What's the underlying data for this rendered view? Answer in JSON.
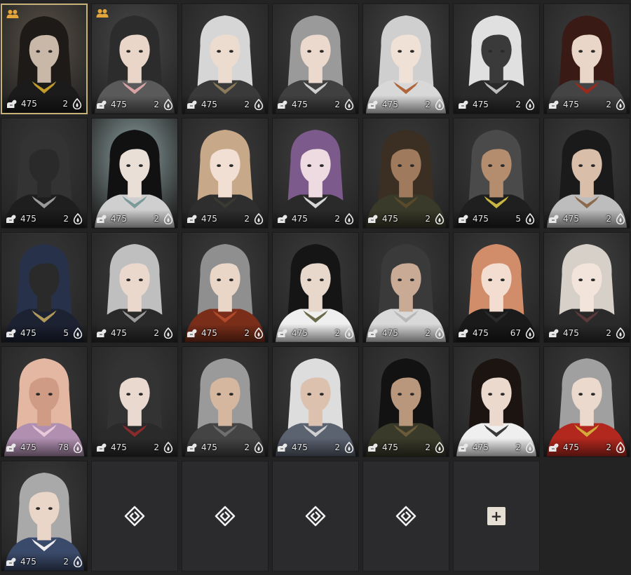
{
  "colors": {
    "background": "#232323",
    "selected_border": "#c9b27a",
    "party_icon": "#e4a63a",
    "empty_slot": "#2b2b2d",
    "add_button": "#e6dfd4"
  },
  "icons": {
    "party": "party-members-icon",
    "combat_power": "flexed-arm-icon",
    "energy": "energy-flame-icon",
    "slot": "diamond-spiral-icon",
    "add": "plus-icon"
  },
  "characters": [
    {
      "cp": "475",
      "energy": "2",
      "party": true,
      "selected": true,
      "look": {
        "hair": "#1d1a17",
        "skin": "#c9b8a8",
        "outfit": "#1b1b1b",
        "accent": "#c19a2b",
        "bg": "#5b5245"
      }
    },
    {
      "cp": "475",
      "energy": "2",
      "party": true,
      "look": {
        "hair": "#2c2c2c",
        "skin": "#e9d6c8",
        "outfit": "#5a5a5a",
        "accent": "#d9a3a3",
        "bg": "#4a4a4a"
      }
    },
    {
      "cp": "475",
      "energy": "2",
      "look": {
        "hair": "#d6d6d6",
        "skin": "#ecdccf",
        "outfit": "#3a3a3a",
        "accent": "#8a7a5a",
        "bg": "#3a3a3a"
      }
    },
    {
      "cp": "475",
      "energy": "2",
      "look": {
        "hair": "#9a9a9a",
        "skin": "#ead9cc",
        "outfit": "#404040",
        "accent": "#cfcfcf",
        "bg": "#3d3d3d"
      }
    },
    {
      "cp": "475",
      "energy": "2",
      "look": {
        "hair": "#cfcfcf",
        "skin": "#f0e1d6",
        "outfit": "#d8d8d8",
        "accent": "#b0653a",
        "bg": "#444444"
      }
    },
    {
      "cp": "475",
      "energy": "2",
      "look": {
        "hair": "#e0e0e0",
        "skin": "#3a3a3a",
        "outfit": "#2a2a2a",
        "accent": "#bdbdbd",
        "bg": "#3b3b3b"
      }
    },
    {
      "cp": "475",
      "energy": "2",
      "look": {
        "hair": "#3a1a14",
        "skin": "#ead6c8",
        "outfit": "#444444",
        "accent": "#9b2a1e",
        "bg": "#3c3c3c"
      }
    },
    {
      "cp": "475",
      "energy": "2",
      "look": {
        "hair": "#333333",
        "skin": "#2a2a2a",
        "outfit": "#1e1e1e",
        "accent": "#9a9a9a",
        "bg": "#383838"
      }
    },
    {
      "cp": "475",
      "energy": "2",
      "look": {
        "hair": "#111111",
        "skin": "#eadfd6",
        "outfit": "#cfcfcf",
        "accent": "#7a9a9a",
        "bg": "#8ea3a3"
      }
    },
    {
      "cp": "475",
      "energy": "2",
      "look": {
        "hair": "#c7a98a",
        "skin": "#f0dfd2",
        "outfit": "#2e2e2e",
        "accent": "#3a3a32",
        "bg": "#3d3d3d"
      }
    },
    {
      "cp": "475",
      "energy": "2",
      "look": {
        "hair": "#7d5a8c",
        "skin": "#eedbe2",
        "outfit": "#2a2a2a",
        "accent": "#d8d8d8",
        "bg": "#404040"
      }
    },
    {
      "cp": "475",
      "energy": "2",
      "look": {
        "hair": "#3a2f22",
        "skin": "#a07a5c",
        "outfit": "#3a3a2a",
        "accent": "#5a4a2a",
        "bg": "#3b3b3b"
      }
    },
    {
      "cp": "475",
      "energy": "5",
      "look": {
        "hair": "#4a4a4a",
        "skin": "#b48c6e",
        "outfit": "#1f1f1f",
        "accent": "#c9b640",
        "bg": "#3a3a3a"
      }
    },
    {
      "cp": "475",
      "energy": "2",
      "look": {
        "hair": "#1a1a1a",
        "skin": "#d9bfa9",
        "outfit": "#bdbdbd",
        "accent": "#8a6a4a",
        "bg": "#3c3c3c"
      }
    },
    {
      "cp": "475",
      "energy": "5",
      "look": {
        "hair": "#27324a",
        "skin": "#2a2a2a",
        "outfit": "#1d2233",
        "accent": "#b29a5a",
        "bg": "#383838"
      }
    },
    {
      "cp": "475",
      "energy": "2",
      "look": {
        "hair": "#bfbfbf",
        "skin": "#ead8cc",
        "outfit": "#2a2a2a",
        "accent": "#9a9a9a",
        "bg": "#3b3b3b"
      }
    },
    {
      "cp": "475",
      "energy": "2",
      "look": {
        "hair": "#8f8f8f",
        "skin": "#ead6c7",
        "outfit": "#7a2e1a",
        "accent": "#b04a2a",
        "bg": "#3d3d3d"
      }
    },
    {
      "cp": "475",
      "energy": "2",
      "look": {
        "hair": "#151515",
        "skin": "#e8d8cc",
        "outfit": "#efefef",
        "accent": "#6a6a4a",
        "bg": "#3c3c3c"
      }
    },
    {
      "cp": "475",
      "energy": "2",
      "look": {
        "hair": "#3a3a3a",
        "skin": "#c9ab95",
        "outfit": "#d9d9d9",
        "accent": "#b8b8b8",
        "bg": "#3a3a3a"
      }
    },
    {
      "cp": "475",
      "energy": "67",
      "look": {
        "hair": "#d18c6a",
        "skin": "#f2ddd0",
        "outfit": "#1a1a1a",
        "accent": "#2a2a2a",
        "bg": "#3d3d3d"
      }
    },
    {
      "cp": "475",
      "energy": "2",
      "look": {
        "hair": "#d6d0c8",
        "skin": "#f2e4da",
        "outfit": "#2a2a2a",
        "accent": "#5a3a3a",
        "bg": "#444444"
      }
    },
    {
      "cp": "475",
      "energy": "78",
      "look": {
        "hair": "#e3b7a2",
        "skin": "#cf9b85",
        "outfit": "#b08fb0",
        "accent": "#e7c9d8",
        "bg": "#3a3a3a"
      }
    },
    {
      "cp": "475",
      "energy": "2",
      "look": {
        "hair": "#333333",
        "skin": "#ead9cf",
        "outfit": "#2a2a2a",
        "accent": "#8a2a2a",
        "bg": "#3a3a3a"
      }
    },
    {
      "cp": "475",
      "energy": "2",
      "look": {
        "hair": "#9a9a9a",
        "skin": "#d5b69f",
        "outfit": "#444444",
        "accent": "#6f6f6f",
        "bg": "#3c3c3c"
      }
    },
    {
      "cp": "475",
      "energy": "2",
      "look": {
        "hair": "#dddddd",
        "skin": "#dcc1ae",
        "outfit": "#5b6270",
        "accent": "#cfcfcf",
        "bg": "#3e3e3e"
      }
    },
    {
      "cp": "475",
      "energy": "2",
      "look": {
        "hair": "#121212",
        "skin": "#b9977c",
        "outfit": "#3a3a2a",
        "accent": "#6a5a3a",
        "bg": "#3a3a3a"
      }
    },
    {
      "cp": "475",
      "energy": "2",
      "look": {
        "hair": "#1b1411",
        "skin": "#ecd9cd",
        "outfit": "#efefef",
        "accent": "#3a3a3a",
        "bg": "#3b3b3b"
      }
    },
    {
      "cp": "475",
      "energy": "2",
      "look": {
        "hair": "#a0a0a0",
        "skin": "#ecd9cd",
        "outfit": "#b2281e",
        "accent": "#d3a93a",
        "bg": "#3b3b3b"
      }
    },
    {
      "cp": "475",
      "energy": "2",
      "look": {
        "hair": "#a9a9a9",
        "skin": "#ead6c9",
        "outfit": "#3a4a6a",
        "accent": "#eeeeee",
        "bg": "#3c3c3c"
      }
    }
  ],
  "empty_slots": 4,
  "add_slot": true
}
